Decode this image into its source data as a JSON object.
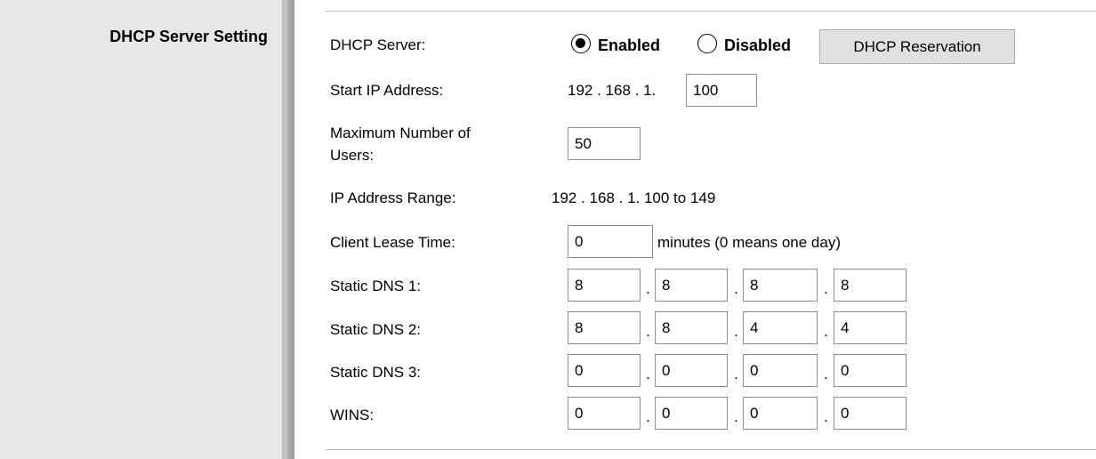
{
  "section_title": "DHCP Server Setting",
  "dhcp_server": {
    "label": "DHCP Server:",
    "enabled_label": "Enabled",
    "disabled_label": "Disabled",
    "selected": "Enabled",
    "reservation_button": "DHCP Reservation"
  },
  "start_ip": {
    "label": "Start IP Address:",
    "prefix": "192 . 168 . 1.",
    "last_octet": "100"
  },
  "max_users": {
    "label_line1": "Maximum Number of",
    "label_line2": "Users:",
    "value": "50"
  },
  "ip_range": {
    "label": "IP Address Range:",
    "value": "192 . 168 . 1. 100 to 149"
  },
  "lease_time": {
    "label": "Client Lease Time:",
    "value": "0",
    "suffix": "minutes (0 means one day)"
  },
  "octet_separator": ".",
  "dns_rows": [
    {
      "label": "Static DNS 1:",
      "octets": [
        "8",
        "8",
        "8",
        "8"
      ]
    },
    {
      "label": "Static DNS 2:",
      "octets": [
        "8",
        "8",
        "4",
        "4"
      ]
    },
    {
      "label": "Static DNS 3:",
      "octets": [
        "0",
        "0",
        "0",
        "0"
      ]
    },
    {
      "label": "WINS:",
      "octets": [
        "0",
        "0",
        "0",
        "0"
      ]
    }
  ]
}
